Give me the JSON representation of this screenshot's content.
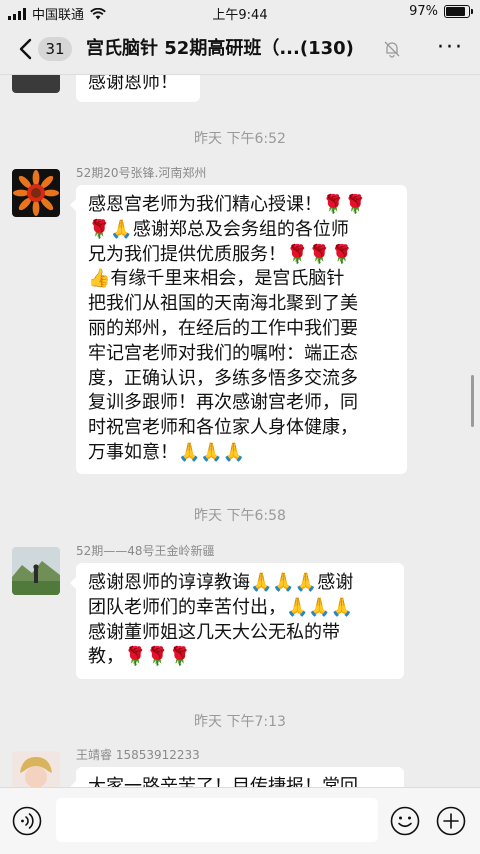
{
  "status": {
    "carrier": "中国联通",
    "time": "上午9:44",
    "battery": "97%",
    "battery_level": 0.97
  },
  "header": {
    "back_count": "31",
    "title": "宫氏脑针 52期高研班（...",
    "member_count": "(130)",
    "more": "···"
  },
  "messages": [
    {
      "type": "partial",
      "text": "感谢恩师！"
    },
    {
      "type": "time",
      "text": "昨天 下午6:52"
    },
    {
      "type": "msg",
      "sender": "52期20号张锋.河南郑州",
      "lines": [
        "感恩宫老师为我们精心授课！🌹🌹",
        "🌹🙏感谢郑总及会务组的各位师",
        "兄为我们提供优质服务！🌹🌹🌹",
        "👍有缘千里来相会，是宫氏脑针",
        "把我们从祖国的天南海北聚到了美",
        "丽的郑州，在经后的工作中我们要",
        "牢记宫老师对我们的嘱咐：端正态",
        "度，正确认识，多练多悟多交流多",
        "复训多跟师！再次感谢宫老师，同",
        "时祝宫老师和各位家人身体健康，",
        "万事如意！🙏🙏🙏"
      ]
    },
    {
      "type": "time",
      "text": "昨天 下午6:58"
    },
    {
      "type": "msg",
      "sender": "52期——48号王金岭新疆",
      "lines": [
        "感谢恩师的谆谆教诲🙏🙏🙏感谢",
        "团队老师们的幸苦付出，🙏🙏🙏",
        "感谢董师姐这几天大公无私的带",
        "教，🌹🌹🌹"
      ]
    },
    {
      "type": "time",
      "text": "昨天 下午7:13"
    },
    {
      "type": "msg",
      "sender": "王靖睿 15853912233",
      "lines": [
        "大家一路辛苦了！目传捷报！常回"
      ]
    }
  ],
  "colors": {
    "background": "#ededed",
    "bubble": "#ffffff",
    "timestamp": "#9a9a9a"
  }
}
